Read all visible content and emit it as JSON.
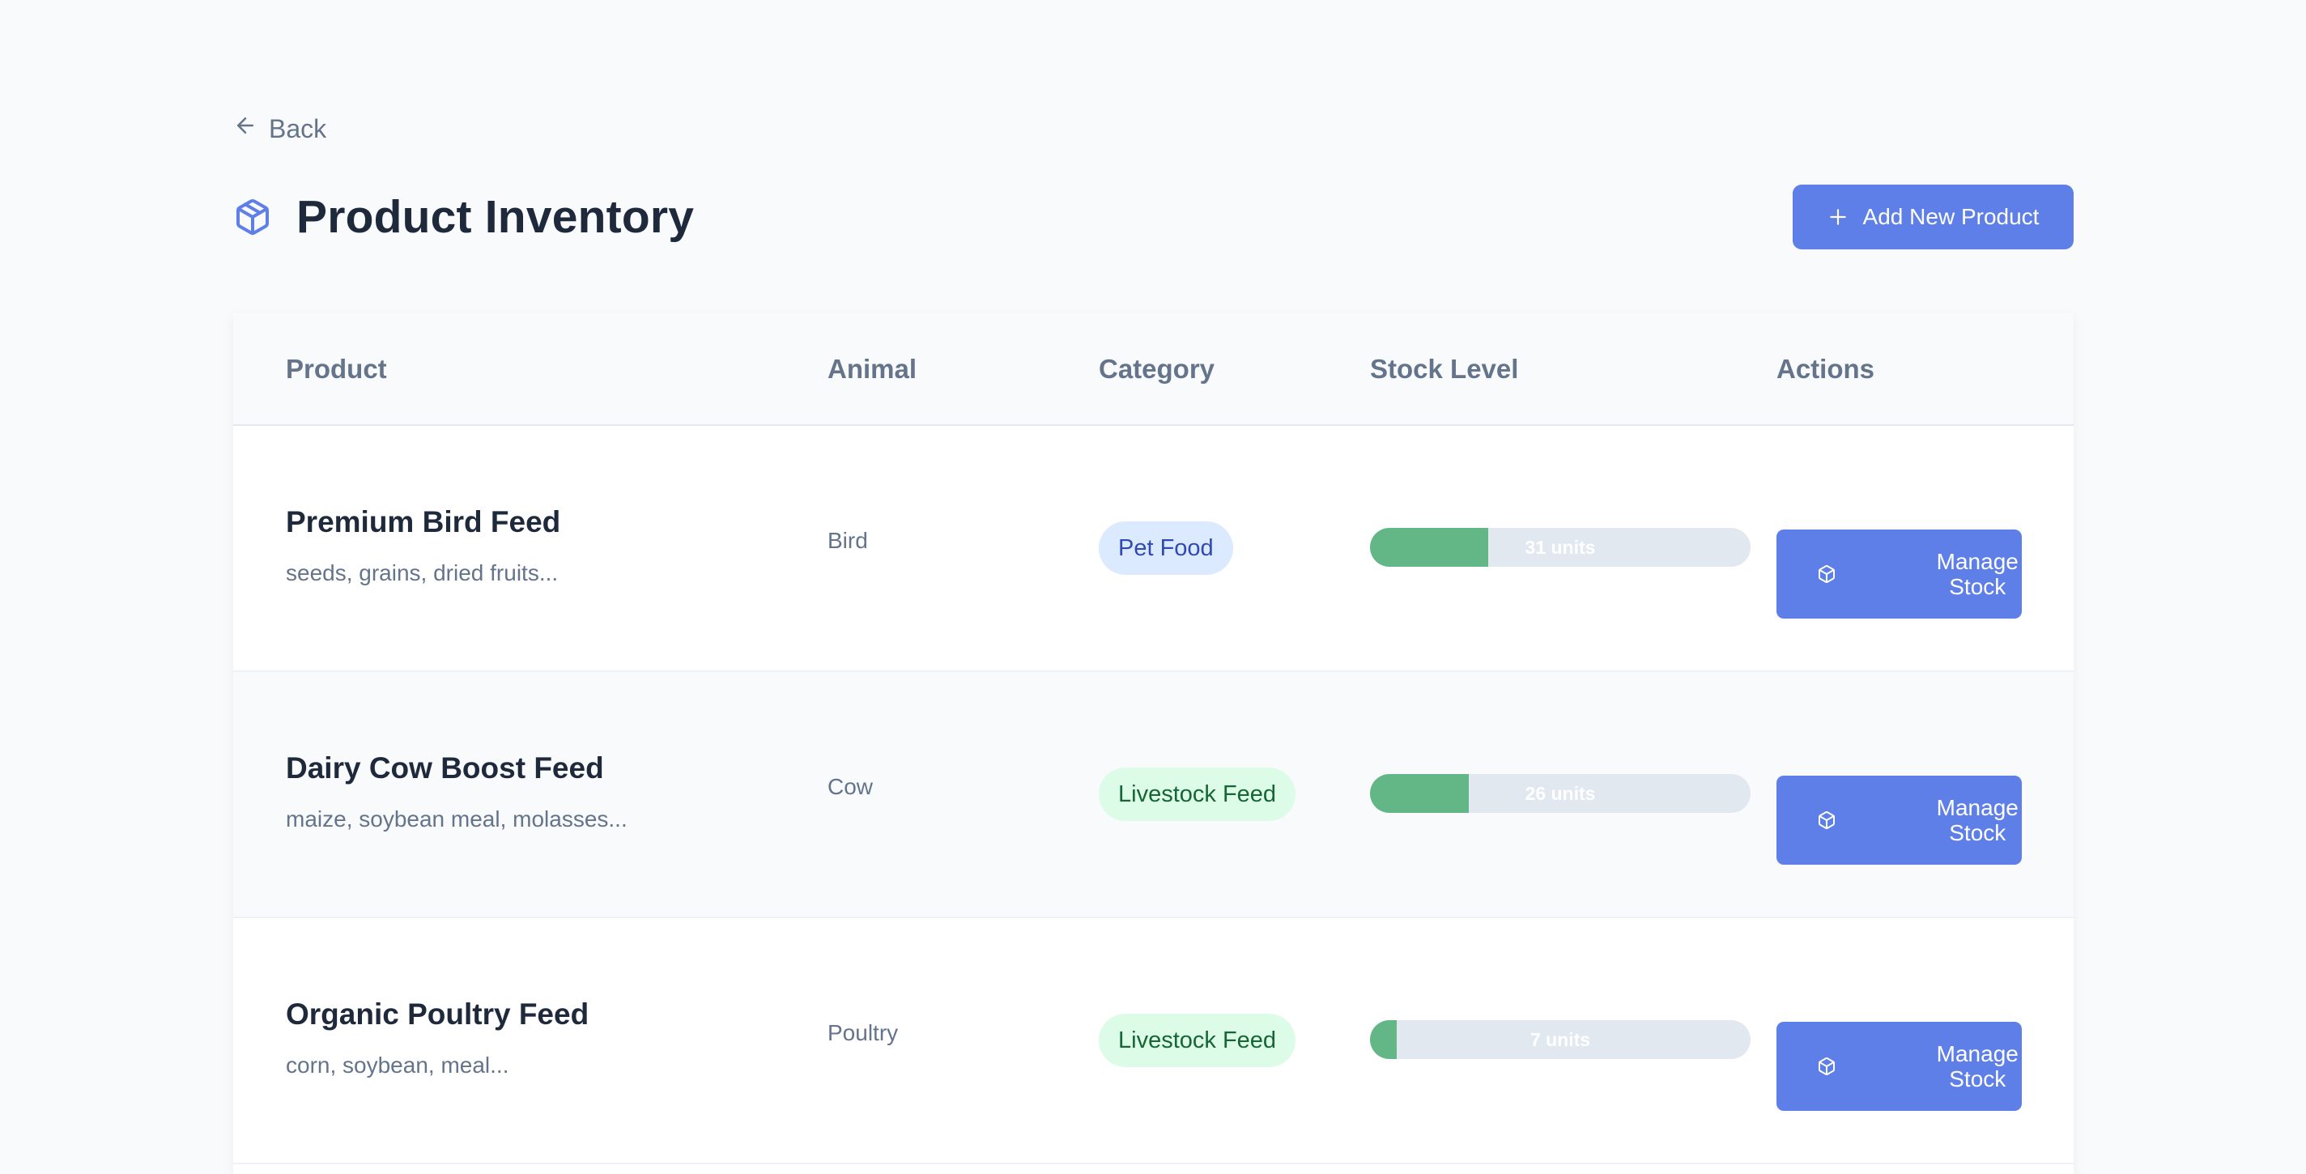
{
  "nav": {
    "back_label": "Back"
  },
  "header": {
    "title": "Product Inventory",
    "add_button_label": "Add New Product"
  },
  "table": {
    "columns": [
      "Product",
      "Animal",
      "Category",
      "Stock Level",
      "Actions"
    ],
    "rows": [
      {
        "name": "Premium Bird Feed",
        "description": "seeds, grains, dried fruits...",
        "animal": "Bird",
        "category": "Pet Food",
        "category_type": "pet",
        "stock_label": "31 units",
        "stock_fraction": 0.31,
        "action_label": "Manage Stock"
      },
      {
        "name": "Dairy Cow Boost Feed",
        "description": "maize, soybean meal, molasses...",
        "animal": "Cow",
        "category": "Livestock Feed",
        "category_type": "livestock",
        "stock_label": "26 units",
        "stock_fraction": 0.26,
        "action_label": "Manage Stock"
      },
      {
        "name": "Organic Poultry Feed",
        "description": "corn, soybean, meal...",
        "animal": "Poultry",
        "category": "Livestock Feed",
        "category_type": "livestock",
        "stock_label": "7 units",
        "stock_fraction": 0.07,
        "action_label": "Manage Stock"
      }
    ]
  },
  "colors": {
    "primary": "#5f7fe8",
    "stock_fill": "#63b685",
    "pet_badge_bg": "#dbeafe",
    "livestock_badge_bg": "#dcfce7"
  },
  "icons": {
    "back": "arrow-left-icon",
    "title": "package-icon",
    "add": "plus-icon",
    "manage": "package-icon"
  }
}
